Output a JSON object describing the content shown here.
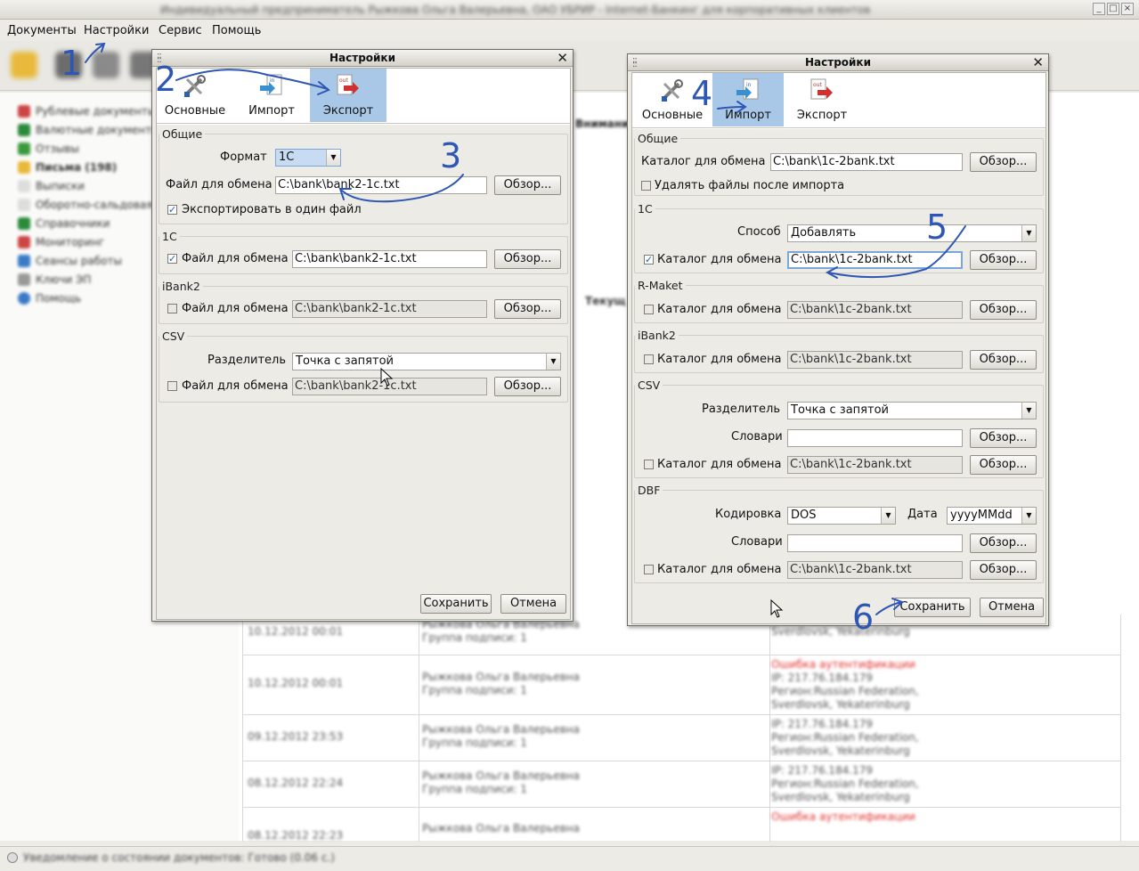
{
  "window": {
    "title": "Индивидуальный предприниматель Рыжкова Ольга Валерьевна, ОАО УБРИР - Internet-Банкинг для корпоративных клиентов"
  },
  "menu": {
    "items": [
      "Документы",
      "Настройки",
      "Сервис",
      "Помощь"
    ]
  },
  "sidebar": {
    "items": [
      "Рублевые документы",
      "Валютные документы",
      "Отзывы",
      "Письма (198)",
      "Выписки",
      "Оборотно-сальдовая",
      "Справочники",
      "Мониторинг",
      "Сеансы работы",
      "Ключи ЭП",
      "Помощь"
    ]
  },
  "background": {
    "header_fragment": "Внимание!",
    "col_fragment": "Текущ",
    "rows": [
      {
        "date": "10.12.2012 00:01",
        "name": "Рыжкова Ольга Валерьевна",
        "group": "Группа подписи: 1",
        "err": "",
        "ip": "",
        "region": "Sverdlovsk, Yekaterinburg"
      },
      {
        "date": "10.12.2012 00:01",
        "name": "Рыжкова Ольга Валерьевна",
        "group": "Группа подписи: 1",
        "err": "Ошибка аутентификации",
        "ip": "IP: 217.76.184.179",
        "region": "Регион:Russian Federation, Sverdlovsk, Yekaterinburg"
      },
      {
        "date": "09.12.2012 23:53",
        "name": "Рыжкова Ольга Валерьевна",
        "group": "Группа подписи: 1",
        "err": "",
        "ip": "IP: 217.76.184.179",
        "region": "Регион:Russian Federation, Sverdlovsk, Yekaterinburg"
      },
      {
        "date": "08.12.2012 22:24",
        "name": "Рыжкова Ольга Валерьевна",
        "group": "Группа подписи: 1",
        "err": "",
        "ip": "IP: 217.76.184.179",
        "region": "Регион:Russian Federation, Sverdlovsk, Yekaterinburg"
      },
      {
        "date": "08.12.2012 22:23",
        "name": "Рыжкова Ольга Валерьевна",
        "group": "Группа подписи: 1",
        "err": "Ошибка аутентификации",
        "ip": "",
        "region": ""
      }
    ]
  },
  "status": {
    "text": "Уведомление о состоянии документов: Готово (0.06 с.)"
  },
  "annotations": [
    "1",
    "2",
    "3",
    "4",
    "5",
    "6"
  ],
  "dialog_export": {
    "title": "Настройки",
    "tabs": [
      "Основные",
      "Импорт",
      "Экспорт"
    ],
    "active_tab": "Экспорт",
    "general": {
      "legend": "Общие",
      "format_label": "Формат",
      "format_value": "1С",
      "file_label": "Файл для обмена",
      "file_value": "C:\\bank\\bank2-1c.txt",
      "browse": "Обзор...",
      "single_file_label": "Экспортировать в один файл",
      "single_file_checked": true
    },
    "g1c": {
      "legend": "1С",
      "checked": true,
      "label": "Файл для обмена",
      "value": "C:\\bank\\bank2-1c.txt",
      "browse": "Обзор..."
    },
    "gibank": {
      "legend": "iBank2",
      "checked": false,
      "label": "Файл для обмена",
      "value": "C:\\bank\\bank2-1c.txt",
      "browse": "Обзор..."
    },
    "gcsv": {
      "legend": "CSV",
      "sep_label": "Разделитель",
      "sep_value": "Точка с запятой",
      "checked": false,
      "label": "Файл для обмена",
      "value": "C:\\bank\\bank2-1c.txt",
      "browse": "Обзор..."
    },
    "save": "Сохранить",
    "cancel": "Отмена"
  },
  "dialog_import": {
    "title": "Настройки",
    "tabs": [
      "Основные",
      "Импорт",
      "Экспорт"
    ],
    "active_tab": "Импорт",
    "general": {
      "legend": "Общие",
      "dir_label": "Каталог для обмена",
      "dir_value": "C:\\bank\\1c-2bank.txt",
      "browse": "Обзор...",
      "delete_label": "Удалять файлы после импорта",
      "delete_checked": false
    },
    "g1c": {
      "legend": "1С",
      "mode_label": "Способ",
      "mode_value": "Добавлять",
      "checked": true,
      "label": "Каталог для обмена",
      "value": "C:\\bank\\1c-2bank.txt",
      "browse": "Обзор..."
    },
    "grmaket": {
      "legend": "R-Maket",
      "checked": false,
      "label": "Каталог для обмена",
      "value": "C:\\bank\\1c-2bank.txt",
      "browse": "Обзор..."
    },
    "gibank": {
      "legend": "iBank2",
      "checked": false,
      "label": "Каталог для обмена",
      "value": "C:\\bank\\1c-2bank.txt",
      "browse": "Обзор..."
    },
    "gcsv": {
      "legend": "CSV",
      "sep_label": "Разделитель",
      "sep_value": "Точка с запятой",
      "dict_label": "Словари",
      "dict_value": "",
      "checked": false,
      "label": "Каталог для обмена",
      "value": "C:\\bank\\1c-2bank.txt",
      "browse": "Обзор..."
    },
    "gdbf": {
      "legend": "DBF",
      "enc_label": "Кодировка",
      "enc_value": "DOS",
      "date_label": "Дата",
      "date_value": "yyyyMMdd",
      "dict_label": "Словари",
      "dict_value": "",
      "checked": false,
      "label": "Каталог для обмена",
      "value": "C:\\bank\\1c-2bank.txt",
      "browse": "Обзор..."
    },
    "save": "Сохранить",
    "cancel": "Отмена"
  },
  "colors": {
    "annotation": "#2e56b5",
    "active_tab": "#a9c8e8",
    "error_text": "#e03030"
  }
}
